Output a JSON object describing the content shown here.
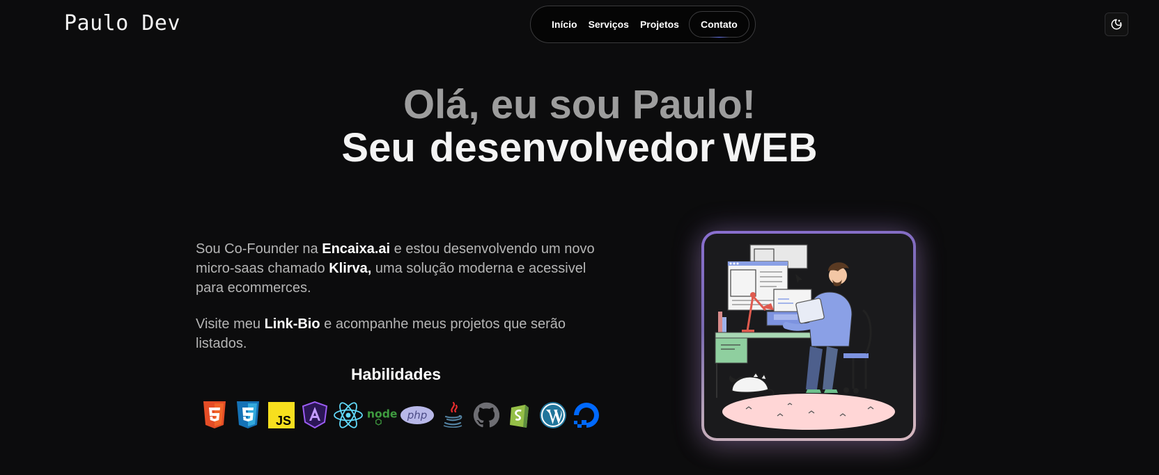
{
  "brand": {
    "logo": "Paulo Dev"
  },
  "nav": {
    "items": [
      {
        "label": "Início"
      },
      {
        "label": "Serviços"
      },
      {
        "label": "Projetos"
      }
    ],
    "contact_label": "Contato",
    "theme_toggle_icon": "moon-stars-icon"
  },
  "hero": {
    "line1": "Olá, eu sou Paulo!",
    "line2_prefix": "Seu desenvolvedor",
    "line2_highlight": "WEB"
  },
  "about": {
    "p1_before": "Sou Co-Founder na ",
    "p1_company": "Encaixa.ai",
    "p1_middle": " e estou desenvolvendo um novo micro-saas chamado ",
    "p1_product": "Klirva,",
    "p1_after": " uma solução moderna e acessivel para ecommerces.",
    "p2_before": "Visite meu ",
    "p2_link": "Link-Bio",
    "p2_after": " e acompanhe meus projetos que serão listados."
  },
  "skills": {
    "title": "Habilidades",
    "icons": [
      "html5-icon",
      "css3-icon",
      "javascript-icon",
      "angular-icon",
      "react-icon",
      "nodejs-icon",
      "php-icon",
      "java-icon",
      "github-icon",
      "shopify-icon",
      "wordpress-icon",
      "digitalocean-icon"
    ],
    "js_text": "JS",
    "node_text": "node",
    "php_text": "php"
  },
  "colors": {
    "background": "#0c0c0d",
    "accent_glow": "#8a6fd0"
  }
}
